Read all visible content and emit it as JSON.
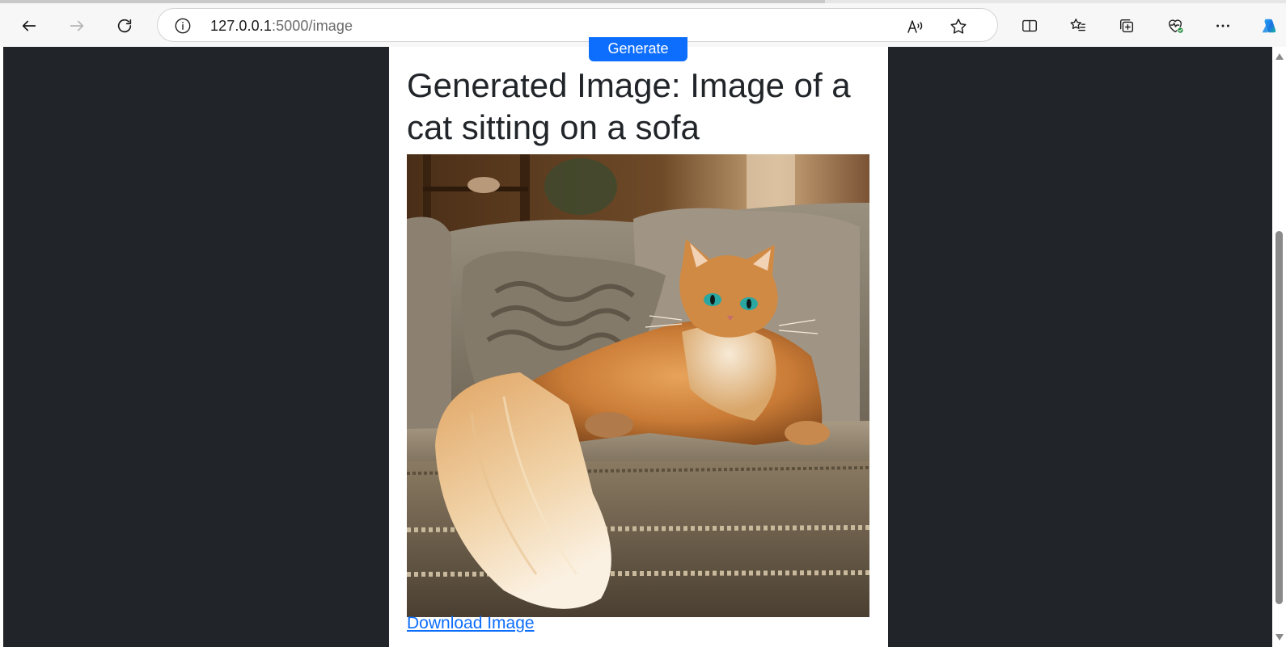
{
  "browser": {
    "url_host": "127.0.0.1",
    "url_path": ":5000/image",
    "icons": {
      "back": "arrow-left-icon",
      "forward": "arrow-right-icon",
      "refresh": "refresh-icon",
      "site_info": "info-icon",
      "read_aloud": "read-aloud-icon",
      "favorite": "star-icon",
      "split_screen": "split-screen-icon",
      "favorites": "favorites-list-icon",
      "collections": "collections-icon",
      "browser_essentials": "heart-pulse-icon",
      "more": "more-icon",
      "copilot": "copilot-icon"
    }
  },
  "page": {
    "generate_button": "Generate",
    "title": "Generated Image: Image of a cat sitting on a sofa",
    "image_alt": "Image of a cat sitting on a sofa",
    "download_link": "Download Image"
  },
  "colors": {
    "page_background": "#212529",
    "primary": "#0d6efd",
    "text": "#212529"
  }
}
